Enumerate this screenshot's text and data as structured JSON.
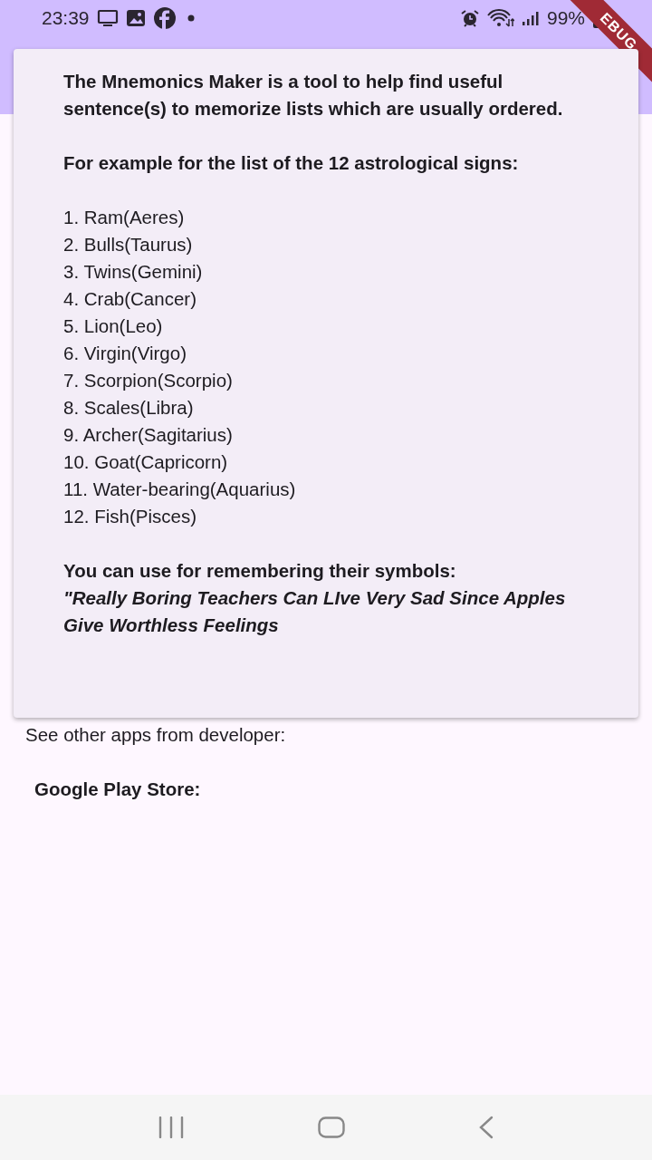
{
  "status_bar": {
    "time": "23:39",
    "battery": "99%"
  },
  "debug_ribbon": "EBUG",
  "dialog": {
    "intro": "The Mnemonics Maker is a tool to help find useful sentence(s) to memorize lists which are usually ordered.",
    "example_heading": "For example for the list of the 12 astrological signs:",
    "list": [
      "1. Ram(Aeres)",
      "2. Bulls(Taurus)",
      "3. Twins(Gemini)",
      "4. Crab(Cancer)",
      "5. Lion(Leo)",
      "6. Virgin(Virgo)",
      "7. Scorpion(Scorpio)",
      "8. Scales(Libra)",
      "9. Archer(Sagitarius)",
      "10. Goat(Capricorn)",
      "11. Water-bearing(Aquarius)",
      "12. Fish(Pisces)"
    ],
    "symbols_label": "You can use for remembering their symbols:",
    "mnemonic": "\"Really Boring Teachers Can LIve Very Sad Since Apples Give Worthless Feelings"
  },
  "page": {
    "other_apps": "See other apps from developer:",
    "store_label": "Google Play Store:"
  }
}
